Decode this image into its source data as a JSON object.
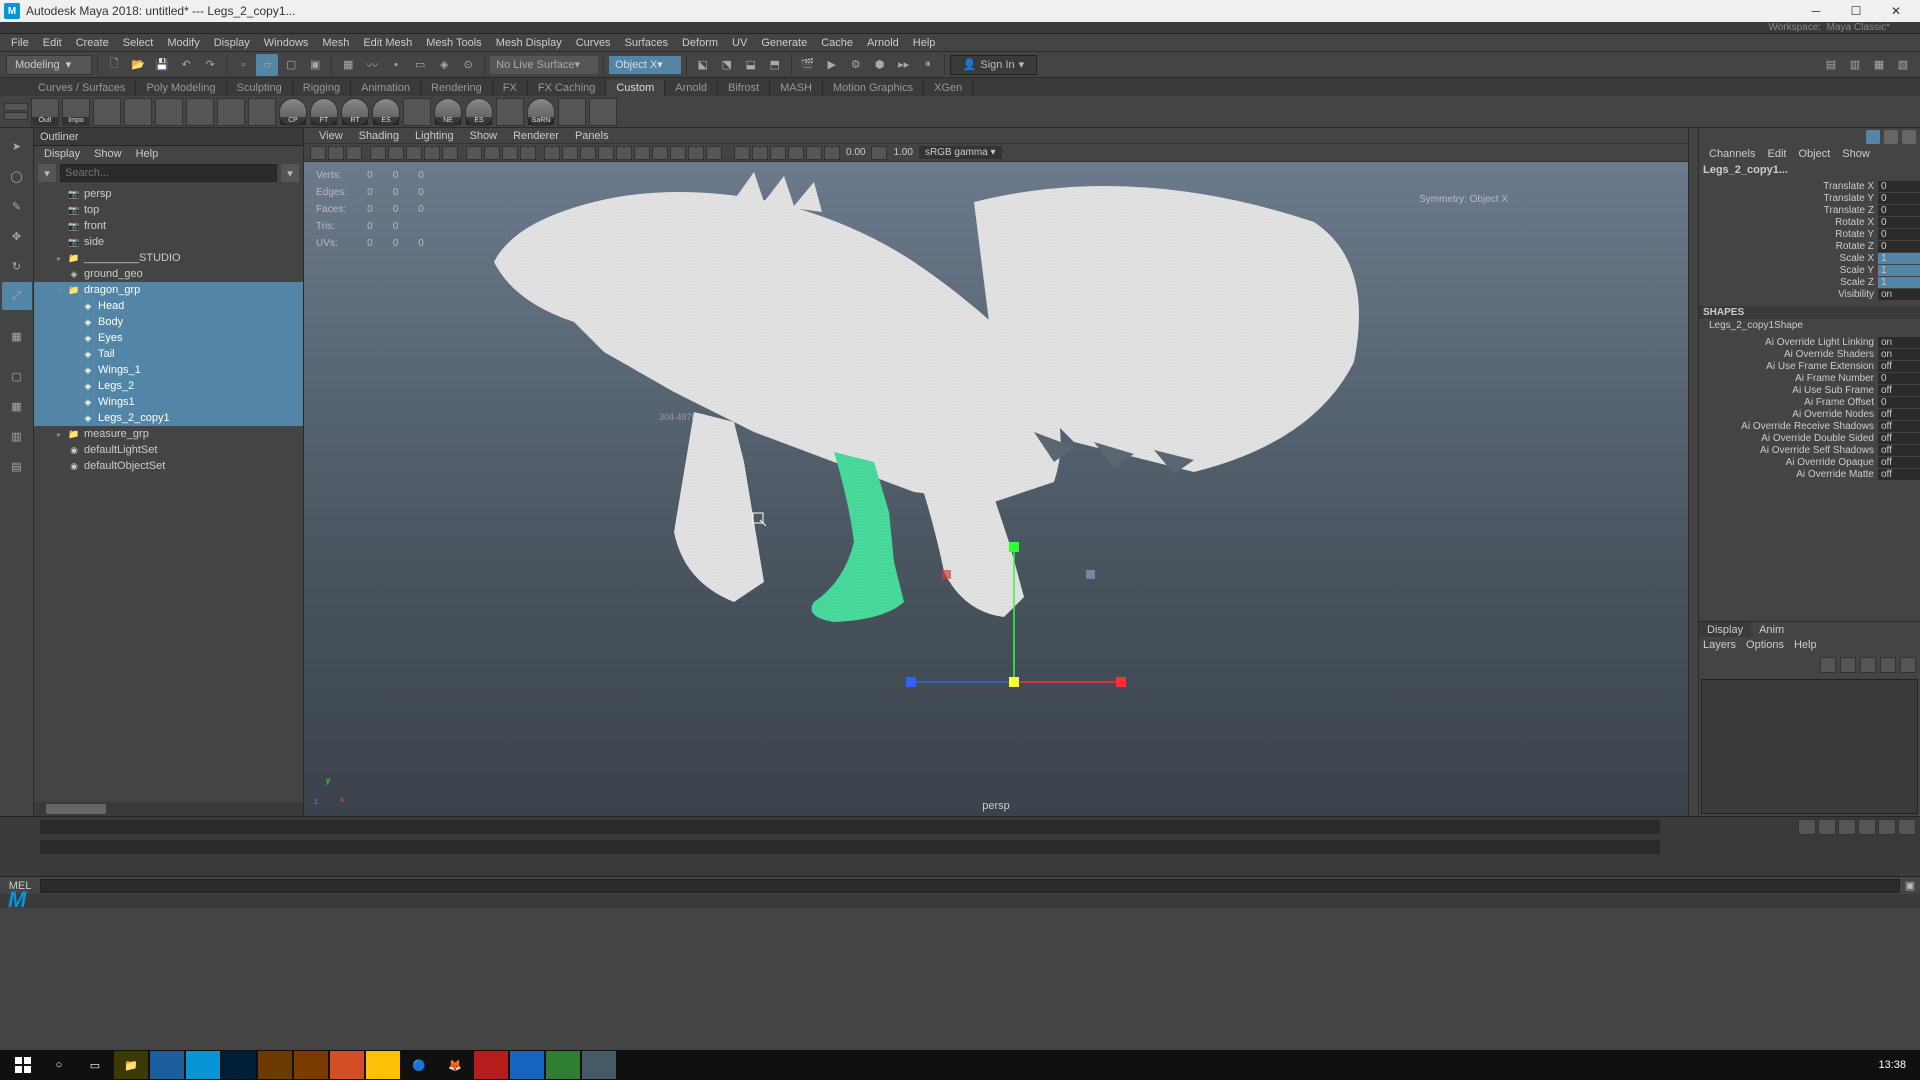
{
  "titlebar": {
    "app": "Autodesk Maya 2018: untitled*  ---  Legs_2_copy1..."
  },
  "workspace": {
    "label": "Workspace:",
    "name": "Maya Classic*"
  },
  "menubar": [
    "File",
    "Edit",
    "Create",
    "Select",
    "Modify",
    "Display",
    "Windows",
    "Mesh",
    "Edit Mesh",
    "Mesh Tools",
    "Mesh Display",
    "Curves",
    "Surfaces",
    "Deform",
    "UV",
    "Generate",
    "Cache",
    "Arnold",
    "Help"
  ],
  "modeSelector": "Modeling",
  "noLive": "No Live Surface",
  "objectSym": "Object X",
  "signin": "Sign In",
  "shelfTabs": [
    "Curves / Surfaces",
    "Poly Modeling",
    "Sculpting",
    "Rigging",
    "Animation",
    "Rendering",
    "FX",
    "FX Caching",
    "Custom",
    "Arnold",
    "Bifrost",
    "MASH",
    "Motion Graphics",
    "XGen"
  ],
  "shelfActive": "Custom",
  "shelfIcons": [
    {
      "name": "outliner-shelf-icon",
      "label": "Outl"
    },
    {
      "name": "import-shelf-icon",
      "label": "Impo"
    },
    {
      "name": "history-shelf-icon",
      "label": ""
    },
    {
      "name": "combine-shelf-icon",
      "label": ""
    },
    {
      "name": "separate-shelf-icon",
      "label": ""
    },
    {
      "name": "sphere-shelf-icon",
      "label": ""
    },
    {
      "name": "cube-shelf-icon",
      "label": ""
    },
    {
      "name": "plane-shelf-icon",
      "label": ""
    },
    {
      "name": "cp-teapot",
      "label": "CP"
    },
    {
      "name": "ft-teapot",
      "label": "FT"
    },
    {
      "name": "rt-teapot",
      "label": "RT"
    },
    {
      "name": "es-teapot",
      "label": "ES"
    },
    {
      "name": "gray-shelf-icon",
      "label": ""
    },
    {
      "name": "ne-teapot",
      "label": "NE"
    },
    {
      "name": "es2-teapot",
      "label": "ES"
    },
    {
      "name": "green-shelf-icon",
      "label": ""
    },
    {
      "name": "sarn-teapot",
      "label": "SaRN"
    },
    {
      "name": "purple-sphere-icon",
      "label": ""
    },
    {
      "name": "trash-shelf-icon",
      "label": ""
    }
  ],
  "outliner": {
    "title": "Outliner",
    "menu": [
      "Display",
      "Show",
      "Help"
    ],
    "searchPlaceholder": "Search...",
    "tree": [
      {
        "name": "persp",
        "indent": 1,
        "icon": "camera",
        "type": "cam"
      },
      {
        "name": "top",
        "indent": 1,
        "icon": "camera",
        "type": "cam"
      },
      {
        "name": "front",
        "indent": 1,
        "icon": "camera",
        "type": "cam"
      },
      {
        "name": "side",
        "indent": 1,
        "icon": "camera",
        "type": "cam"
      },
      {
        "name": "_________STUDIO",
        "indent": 1,
        "icon": "group",
        "arrow": "+"
      },
      {
        "name": "ground_geo",
        "indent": 1,
        "icon": "mesh"
      },
      {
        "name": "dragon_grp",
        "indent": 1,
        "icon": "group",
        "arrow": "-",
        "sel": true
      },
      {
        "name": "Head",
        "indent": 2,
        "icon": "mesh",
        "sel": true
      },
      {
        "name": "Body",
        "indent": 2,
        "icon": "mesh",
        "sel": true
      },
      {
        "name": "Eyes",
        "indent": 2,
        "icon": "mesh",
        "sel": true
      },
      {
        "name": "Tail",
        "indent": 2,
        "icon": "mesh",
        "sel": true
      },
      {
        "name": "Wings_1",
        "indent": 2,
        "icon": "mesh",
        "sel": true
      },
      {
        "name": "Legs_2",
        "indent": 2,
        "icon": "mesh",
        "sel": true
      },
      {
        "name": "Wings1",
        "indent": 2,
        "icon": "mesh",
        "sel": true
      },
      {
        "name": "Legs_2_copy1",
        "indent": 2,
        "icon": "mesh",
        "sel": true
      },
      {
        "name": "measure_grp",
        "indent": 1,
        "icon": "group",
        "arrow": "+"
      },
      {
        "name": "defaultLightSet",
        "indent": 1,
        "icon": "set"
      },
      {
        "name": "defaultObjectSet",
        "indent": 1,
        "icon": "set"
      }
    ]
  },
  "viewport": {
    "menu": [
      "View",
      "Shading",
      "Lighting",
      "Show",
      "Renderer",
      "Panels"
    ],
    "stats": [
      {
        "label": "Verts:",
        "a": "0",
        "b": "0",
        "c": "0"
      },
      {
        "label": "Edges:",
        "a": "0",
        "b": "0",
        "c": "0"
      },
      {
        "label": "Faces:",
        "a": "0",
        "b": "0",
        "c": "0"
      },
      {
        "label": "Tris:",
        "a": "0",
        "b": "0",
        "c": ""
      },
      {
        "label": "UVs:",
        "a": "0",
        "b": "0",
        "c": "0"
      }
    ],
    "symmetry": "Symmetry: Object X",
    "camera": "persp",
    "vnum1": "0.00",
    "vnum2": "1.00",
    "colorspace": "sRGB gamma",
    "hover": "304.487091"
  },
  "channels": {
    "menu": [
      "Channels",
      "Edit",
      "Object",
      "Show"
    ],
    "objName": "Legs_2_copy1...",
    "attrs": [
      {
        "label": "Translate X",
        "val": "0"
      },
      {
        "label": "Translate Y",
        "val": "0"
      },
      {
        "label": "Translate Z",
        "val": "0"
      },
      {
        "label": "Rotate X",
        "val": "0"
      },
      {
        "label": "Rotate Y",
        "val": "0"
      },
      {
        "label": "Rotate Z",
        "val": "0"
      },
      {
        "label": "Scale X",
        "val": "1",
        "hl": true
      },
      {
        "label": "Scale Y",
        "val": "1",
        "hl": true
      },
      {
        "label": "Scale Z",
        "val": "1",
        "hl": true
      },
      {
        "label": "Visibility",
        "val": "on"
      }
    ],
    "shapesHdr": "SHAPES",
    "shapeName": "Legs_2_copy1Shape",
    "shapeAttrs": [
      {
        "label": "Ai Override Light Linking",
        "val": "on"
      },
      {
        "label": "Ai Override Shaders",
        "val": "on"
      },
      {
        "label": "Ai Use Frame Extension",
        "val": "off"
      },
      {
        "label": "Ai Frame Number",
        "val": "0"
      },
      {
        "label": "Ai Use Sub Frame",
        "val": "off"
      },
      {
        "label": "Ai Frame Offset",
        "val": "0"
      },
      {
        "label": "Ai Override Nodes",
        "val": "off"
      },
      {
        "label": "Ai Override Receive Shadows",
        "val": "off"
      },
      {
        "label": "Ai Override Double Sided",
        "val": "off"
      },
      {
        "label": "Ai Override Self Shadows",
        "val": "off"
      },
      {
        "label": "Ai Override Opaque",
        "val": "off"
      },
      {
        "label": "Ai Override Matte",
        "val": "off"
      }
    ]
  },
  "layers": {
    "tabs": [
      "Display",
      "Anim"
    ],
    "menu": [
      "Layers",
      "Options",
      "Help"
    ]
  },
  "mel": "MEL",
  "clock": "13:38"
}
